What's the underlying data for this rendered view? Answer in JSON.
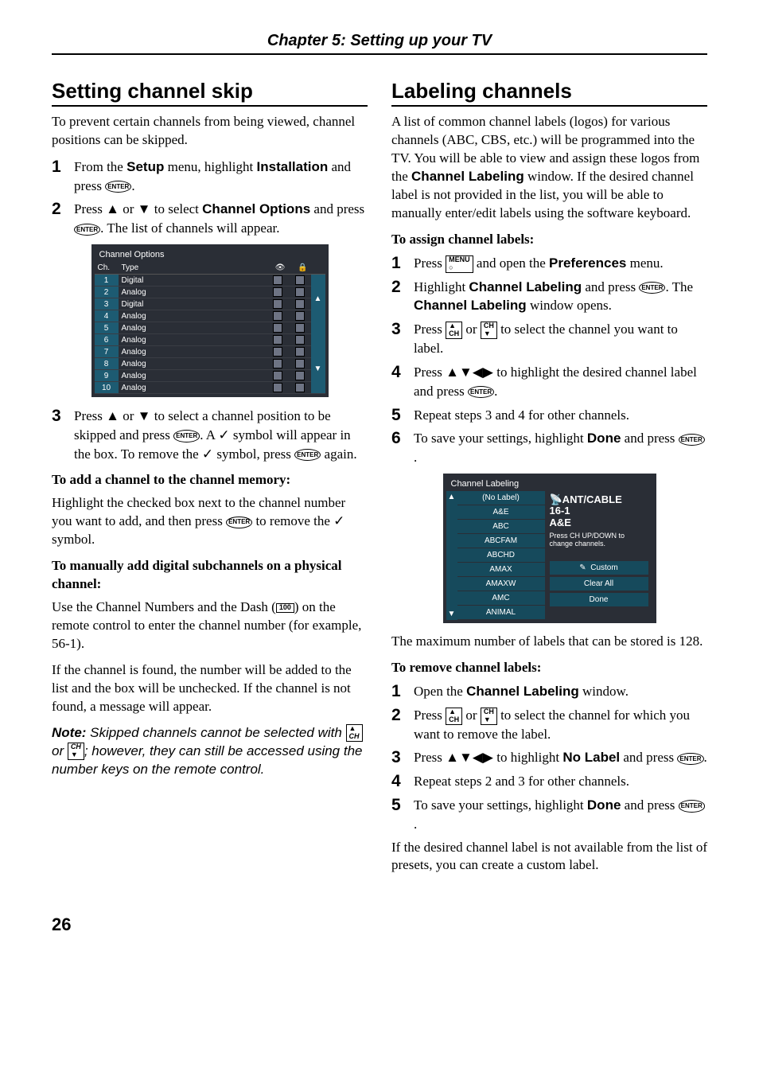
{
  "chapter_title": "Chapter 5: Setting up your TV",
  "page_number": "26",
  "left": {
    "h1": "Setting channel skip",
    "intro": "To prevent certain channels from being viewed, channel positions can be skipped.",
    "step1a": "From the ",
    "step1b": "Setup",
    "step1c": " menu, highlight ",
    "step1d": "Installation",
    "step1e": " and press ",
    "step2a": "Press ",
    "step2b": " or ",
    "step2c": " to select ",
    "step2d": "Channel Options",
    "step2e": " and press ",
    "step2f": ". The list of channels will appear.",
    "table_title": "Channel Options",
    "th_ch": "Ch.",
    "th_type": "Type",
    "rows": [
      {
        "ch": "1",
        "type": "Digital"
      },
      {
        "ch": "2",
        "type": "Analog"
      },
      {
        "ch": "3",
        "type": "Digital"
      },
      {
        "ch": "4",
        "type": "Analog"
      },
      {
        "ch": "5",
        "type": "Analog"
      },
      {
        "ch": "6",
        "type": "Analog"
      },
      {
        "ch": "7",
        "type": "Analog"
      },
      {
        "ch": "8",
        "type": "Analog"
      },
      {
        "ch": "9",
        "type": "Analog"
      },
      {
        "ch": "10",
        "type": "Analog"
      }
    ],
    "step3a": "Press ",
    "step3b": " or ",
    "step3c": " to select a channel position to be skipped and press ",
    "step3d": ". A ",
    "step3e": " symbol will appear in the box. To remove the ",
    "step3f": " symbol, press ",
    "step3g": " again.",
    "sub_add": "To add a channel to the channel memory:",
    "p_add_a": "Highlight the checked box next to the channel number you want to add, and then press ",
    "p_add_b": " to remove the ",
    "p_add_c": " symbol.",
    "sub_man": "To manually add digital subchannels on a physical channel:",
    "p_man_a": "Use the Channel Numbers and the Dash (",
    "p_man_b": ") on the remote control to enter the channel number (for example, 56-1).",
    "p_man_c": "If the channel is found, the number will be added to the list and the box will be unchecked. If the channel is not found, a message will appear.",
    "note_lead": "Note:",
    "note_a": " Skipped channels cannot be selected with ",
    "note_b": " or ",
    "note_c": "; however, they can still be accessed using the number keys on the remote control."
  },
  "right": {
    "h1": "Labeling channels",
    "intro_a": "A list of common channel labels (logos) for various channels (ABC, CBS, etc.) will be programmed into the TV. You will be able to view and assign these logos from the ",
    "intro_b": "Channel Labeling",
    "intro_c": " window. If the desired channel label is not provided in the list, you will be able to manually enter/edit labels using the software keyboard.",
    "sub_assign": "To assign channel labels:",
    "a1a": "Press ",
    "a1b": " and open the ",
    "a1c": "Preferences",
    "a1d": " menu.",
    "a2a": "Highlight ",
    "a2b": "Channel Labeling",
    "a2c": " and press ",
    "a2d": ". The ",
    "a2e": "Channel Labeling",
    "a2f": " window opens.",
    "a3a": "Press ",
    "a3b": " or ",
    "a3c": " to select the channel you want to label.",
    "a4a": "Press ",
    "a4b": " to highlight the desired channel label and press ",
    "a5": "Repeat steps 3 and 4 for other channels.",
    "a6a": "To save your settings, highlight ",
    "a6b": "Done",
    "a6c": " and press ",
    "shot2_title": "Channel Labeling",
    "shot2_list": [
      "(No Label)",
      "A&E",
      "ABC",
      "ABCFAM",
      "ABCHD",
      "AMAX",
      "AMAXW",
      "AMC",
      "ANIMAL"
    ],
    "shot2_info_line1": "📡ANT/CABLE",
    "shot2_info_line2": "16-1",
    "shot2_info_line3": "A&E",
    "shot2_info_line4": "Press CH UP/DOWN to",
    "shot2_info_line5": "change channels.",
    "shot2_btn_custom": "Custom",
    "shot2_btn_clear": "Clear All",
    "shot2_btn_done": "Done",
    "p_max": "The maximum number of labels that can be stored is 128.",
    "sub_remove": "To remove channel labels:",
    "r1a": "Open the ",
    "r1b": "Channel Labeling",
    "r1c": " window.",
    "r2a": "Press ",
    "r2b": " or ",
    "r2c": " to select the channel for which you want to remove the label.",
    "r3a": "Press ",
    "r3b": " to highlight ",
    "r3c": "No Label",
    "r3d": " and press ",
    "r4": "Repeat steps 2 and 3 for other channels.",
    "r5a": "To save your settings, highlight ",
    "r5b": "Done",
    "r5c": " and press ",
    "p_last": "If the desired channel label is not available from the list of presets, you can create a custom label."
  },
  "keys": {
    "enter": "ENTER",
    "menu_top": "MENU",
    "menu_bottom": "○",
    "ch_up_top": "▲",
    "ch_up_bottom": "CH",
    "ch_dn_top": "CH",
    "ch_dn_bottom": "▼",
    "dash_key": "1̅0̅0̅",
    "pencil": "✎"
  },
  "glyphs": {
    "up": "▲",
    "down": "▼",
    "left": "◀",
    "right": "▶",
    "check": "✓",
    "eye": "👁",
    "lock": "🔒"
  }
}
